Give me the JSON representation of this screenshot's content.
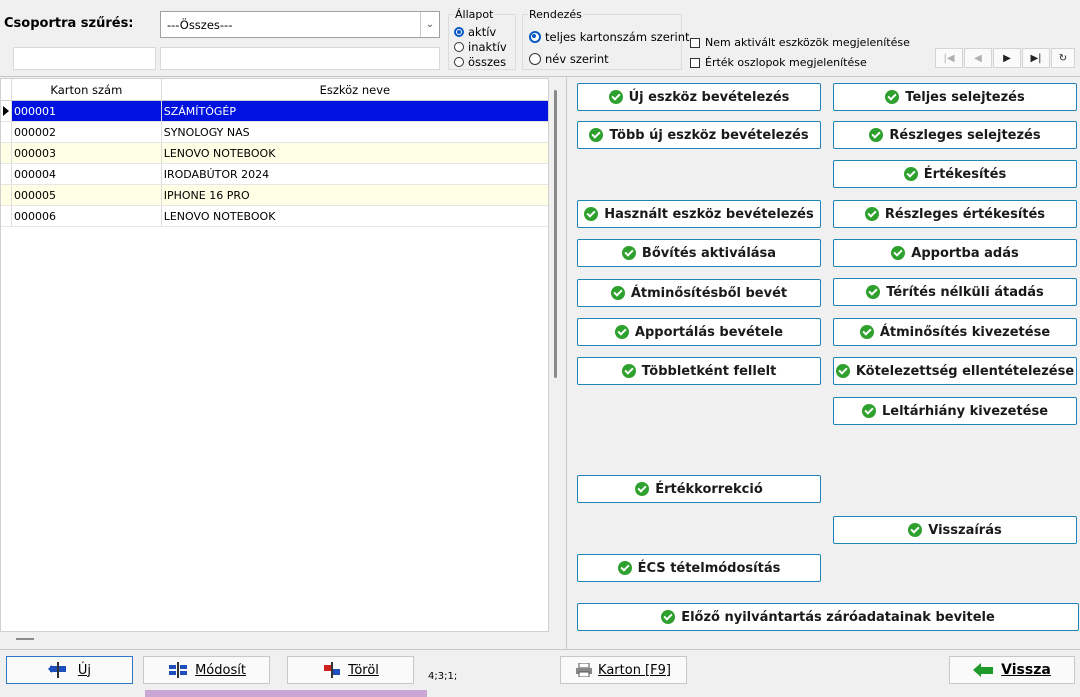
{
  "filter": {
    "label": "Csoportra szűrés:",
    "group_value": "---Összes---"
  },
  "status": {
    "title": "Állapot",
    "options": [
      {
        "label": "aktív",
        "checked": true
      },
      {
        "label": "inaktív",
        "checked": false
      },
      {
        "label": "összes",
        "checked": false
      }
    ]
  },
  "sort": {
    "title": "Rendezés",
    "options": [
      {
        "label": "teljes kartonszám szerint",
        "checked": true
      },
      {
        "label": "név szerint",
        "checked": false
      }
    ]
  },
  "checks": [
    {
      "label": "Nem aktivált eszközök megjelenítése",
      "checked": false
    },
    {
      "label": "Érték oszlopok megjelenítése",
      "checked": false
    }
  ],
  "nav_icons": [
    "first-icon",
    "prev-icon",
    "next-icon",
    "last-icon",
    "refresh-icon"
  ],
  "grid": {
    "columns": [
      "Karton szám",
      "Eszköz neve"
    ],
    "rows": [
      {
        "code": "000001",
        "name": "SZÁMÍTÓGÉP"
      },
      {
        "code": "000002",
        "name": "SYNOLOGY NAS"
      },
      {
        "code": "000003",
        "name": "LENOVO NOTEBOOK"
      },
      {
        "code": "000004",
        "name": "IRODABÚTOR 2024"
      },
      {
        "code": "000005",
        "name": "IPHONE 16 PRO"
      },
      {
        "code": "000006",
        "name": "LENOVO NOTEBOOK"
      }
    ]
  },
  "actions": {
    "uj_eszkoz": "Új eszköz bevételezés",
    "tobb_uj": "Több új eszköz bevételezés",
    "hasznalt": "Használt eszköz bevételezés",
    "bovites": "Bővítés aktiválása",
    "atminosites_bevet": "Átminősítésből bevét",
    "apportalas": "Apportálás bevétele",
    "tobblet": "Többletként fellelt",
    "ertekkorrekcio": "Értékkorrekció",
    "ecs": "ÉCS tételmódosítás",
    "teljes_selejt": "Teljes selejtezés",
    "reszleges_selejt": "Részleges selejtezés",
    "ertekesites": "Értékesítés",
    "reszleges_ertekesites": "Részleges értékesítés",
    "apportba": "Apportba adás",
    "terites": "Térítés nélküli átadás",
    "atminosites_kivezet": "Átminősítés kivezetése",
    "kotelezettseg": "Kötelezettség ellentételezése",
    "leltarhiany": "Leltárhiány kivezetése",
    "visszairas": "Visszaírás",
    "elozo": "Előző nyilvántartás záróadatainak bevitele"
  },
  "bottom": {
    "new_label": "Új",
    "modify_label": "Módosít",
    "delete_label": "Töröl",
    "status_text": "4;3;1;",
    "card_label": "Karton [F9]",
    "back_label": "Vissza"
  }
}
